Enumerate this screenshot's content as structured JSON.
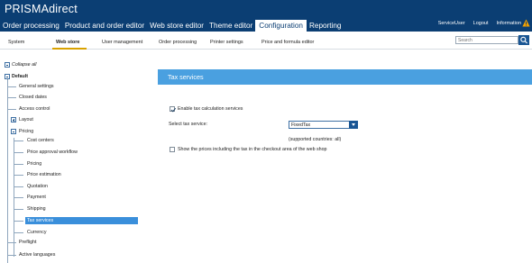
{
  "app": {
    "title": "PRISMAdirect"
  },
  "main_nav": [
    {
      "label": "Order processing",
      "active": false
    },
    {
      "label": "Product and order editor",
      "active": false
    },
    {
      "label": "Web store editor",
      "active": false
    },
    {
      "label": "Theme editor",
      "active": false
    },
    {
      "label": "Configuration",
      "active": true
    },
    {
      "label": "Reporting",
      "active": false
    }
  ],
  "user_links": {
    "user": "ServiceUser",
    "logout": "Logout",
    "information": "Information"
  },
  "sub_nav": [
    {
      "label": "System",
      "active": false
    },
    {
      "label": "Web store",
      "active": true
    },
    {
      "label": "User management",
      "active": false
    },
    {
      "label": "Order processing",
      "active": false
    },
    {
      "label": "Printer settings",
      "active": false
    },
    {
      "label": "Price and formula editor",
      "active": false
    }
  ],
  "search": {
    "placeholder": "Search"
  },
  "tree": {
    "collapse_all": "Collapse all",
    "root": "Default",
    "items": {
      "general_settings": "General settings",
      "closed_dates": "Closed dates",
      "access_control": "Access control",
      "layout": "Layout",
      "pricing": "Pricing",
      "cost_centers": "Cost centers",
      "price_approval_workflow": "Price approval workflow",
      "pricing_child": "Pricing",
      "price_estimation": "Price estimation",
      "quotation": "Quotation",
      "payment": "Payment",
      "shipping": "Shipping",
      "tax_services": "Tax services",
      "currency": "Currency",
      "preflight": "Preflight",
      "active_languages": "Active languages"
    },
    "selected": "tax_services"
  },
  "panel": {
    "title": "Tax services",
    "enable_tax_label": "Enable tax calculation services",
    "enable_tax_checked": true,
    "select_label": "Select tax service:",
    "select_value": "FixedTax",
    "supported_countries": "(supported countries: all)",
    "show_prices_label": "Show the prices including the tax in the checkout area of the web shop",
    "show_prices_checked": false
  },
  "colors": {
    "header_bg": "#0b3e73",
    "panel_header": "#4aa0e0",
    "selected_node": "#3a8fdb",
    "active_underline": "#d9a200",
    "warning": "#f2a000"
  }
}
